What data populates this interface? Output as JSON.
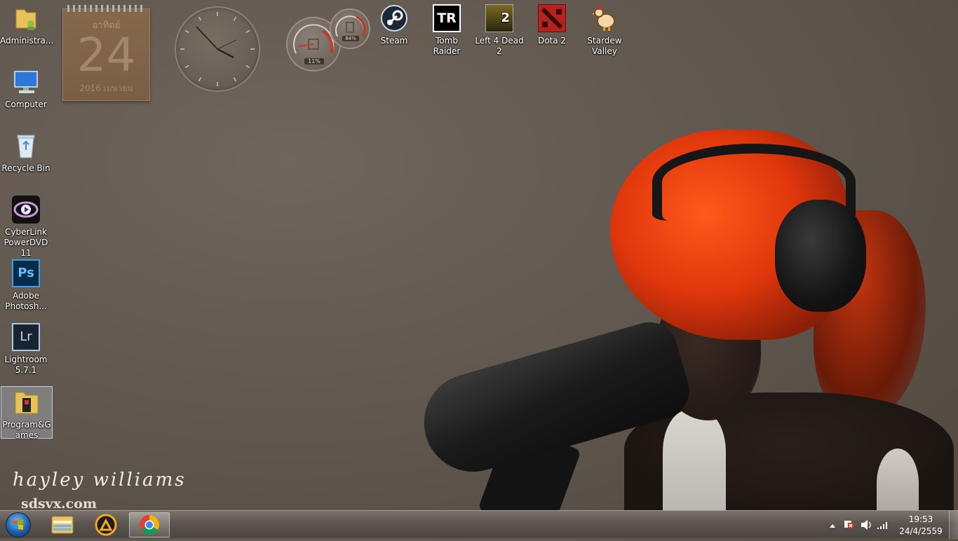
{
  "desktop_icons_left": [
    {
      "label": "Administra...",
      "icon": "user-folder-icon"
    },
    {
      "label": "Computer",
      "icon": "computer-icon"
    },
    {
      "label": "Recycle Bin",
      "icon": "recycle-bin-icon"
    },
    {
      "label": "CyberLink PowerDVD 11",
      "icon": "powerdvd-icon"
    },
    {
      "label": "Adobe Photosh...",
      "icon": "photoshop-icon",
      "glyph": "Ps"
    },
    {
      "label": "Lightroom 5.7.1",
      "icon": "lightroom-icon",
      "glyph": "Lr"
    },
    {
      "label": "Program&Games",
      "icon": "folder-icon"
    }
  ],
  "desktop_icons_top": [
    {
      "label": "Steam",
      "icon": "steam-icon"
    },
    {
      "label": "Tomb Raider",
      "icon": "tomb-raider-icon",
      "glyph": "TR"
    },
    {
      "label": "Left 4 Dead 2",
      "icon": "left-4-dead-2-icon",
      "glyph": "2"
    },
    {
      "label": "Dota 2",
      "icon": "dota-2-icon"
    },
    {
      "label": "Stardew Valley",
      "icon": "stardew-valley-icon"
    }
  ],
  "calendar_gadget": {
    "weekday": "อาทิตย์",
    "day": "24",
    "month_year": "2016 เมษายน"
  },
  "cpu_meter_gadget": {
    "cpu": "11%",
    "memory": "84%"
  },
  "wallpaper": {
    "signature": "hayley williams",
    "site": "sdsvx.com"
  },
  "taskbar": {
    "pinned": [
      {
        "name": "explorer",
        "icon": "windows-explorer-icon"
      },
      {
        "name": "aimp",
        "icon": "aimp-icon"
      },
      {
        "name": "chrome",
        "icon": "chrome-icon"
      }
    ],
    "clock_time": "19:53",
    "clock_date": "24/4/2559"
  }
}
